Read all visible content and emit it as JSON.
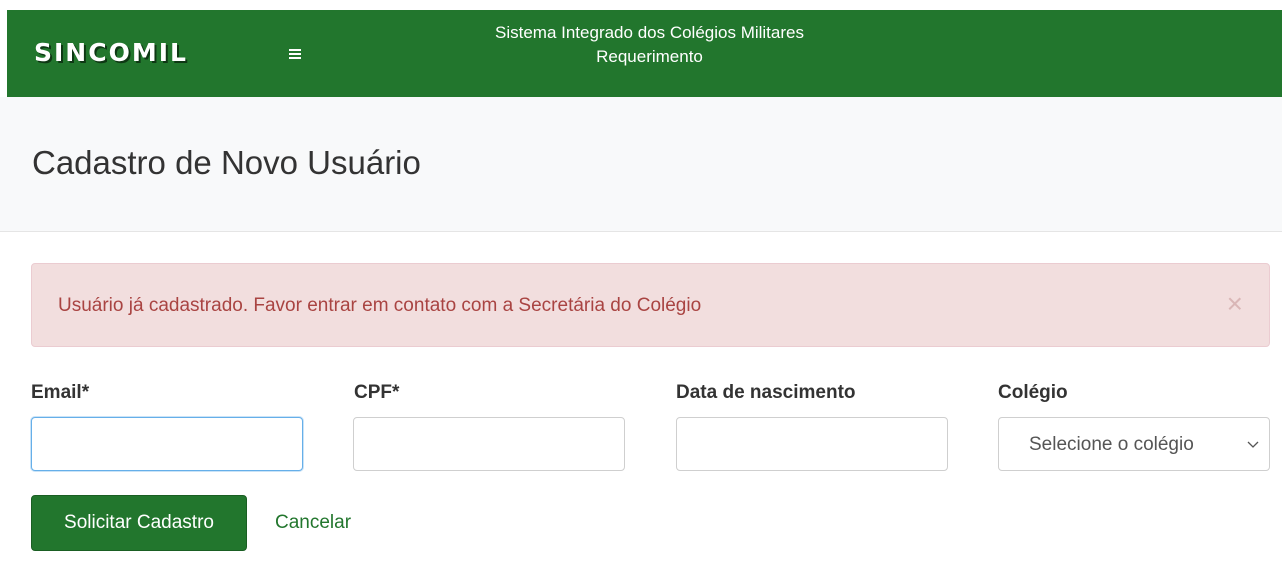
{
  "header": {
    "brand": "SINCOMIL",
    "system_title": "Sistema Integrado dos Colégios Militares",
    "subtitle": "Requerimento",
    "background_color": "#22762d",
    "menu_icon": "hamburger-icon"
  },
  "page": {
    "title": "Cadastro de Novo Usuário"
  },
  "alert": {
    "type": "danger",
    "message": "Usuário já cadastrado. Favor entrar em contato com a Secretária do Colégio",
    "close_symbol": "×",
    "close_icon": "close-icon"
  },
  "form": {
    "email": {
      "label": "Email*",
      "value": "",
      "placeholder": ""
    },
    "cpf": {
      "label": "CPF*",
      "value": "",
      "placeholder": ""
    },
    "birthdate": {
      "label": "Data de nascimento",
      "value": "",
      "placeholder": ""
    },
    "school": {
      "label": "Colégio",
      "selected": "Selecione o colégio",
      "icon": "chevron-down-icon"
    }
  },
  "actions": {
    "submit_label": "Solicitar Cadastro",
    "cancel_label": "Cancelar"
  }
}
